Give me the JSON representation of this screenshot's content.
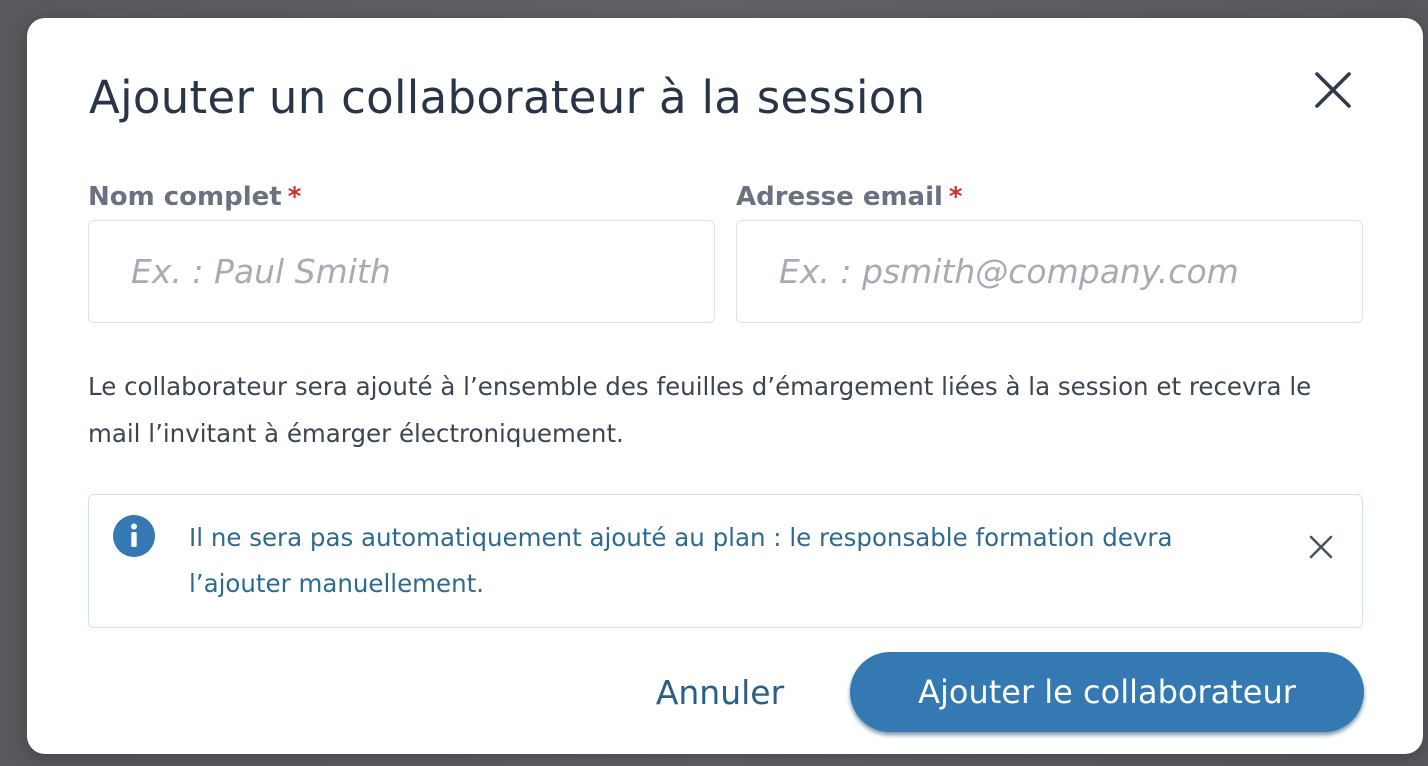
{
  "dialog": {
    "title": "Ajouter un collaborateur à la session",
    "close_icon": "close-icon"
  },
  "form": {
    "name_field": {
      "label": "Nom complet",
      "required_mark": "*",
      "value": "",
      "placeholder": "Ex. : Paul Smith"
    },
    "email_field": {
      "label": "Adresse email",
      "required_mark": "*",
      "value": "",
      "placeholder": "Ex. : psmith@company.com"
    }
  },
  "description": "Le collaborateur sera ajouté à l’ensemble des feuilles d’émargement liées à la session et recevra le mail l’invitant à émarger électroniquement.",
  "info_banner": {
    "icon": "info-icon",
    "text": "Il ne sera pas automatiquement ajouté au plan : le responsable formation devra l’ajouter manuellement.",
    "close_icon": "close-icon"
  },
  "actions": {
    "cancel_label": "Annuler",
    "submit_label": "Ajouter le collaborateur"
  },
  "colors": {
    "title": "#283447",
    "label": "#6b7180",
    "required": "#d0312d",
    "info_text": "#2e6a90",
    "info_icon": "#3479b1",
    "primary_button": "#3479b1",
    "cancel_text": "#2b5f86",
    "backdrop": "#5c5d60"
  }
}
